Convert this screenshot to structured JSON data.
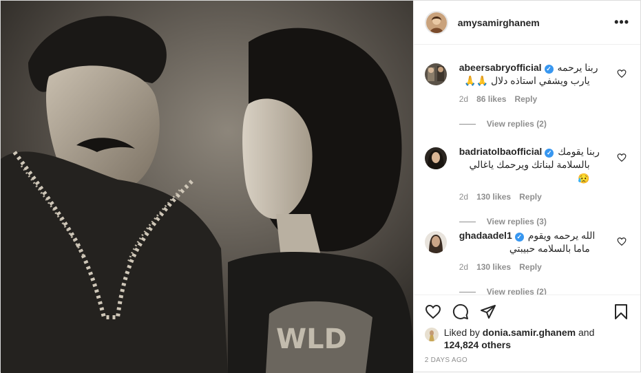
{
  "post": {
    "username": "amysamirghanem",
    "more_label": "•••",
    "photo_alt": "vintage photo"
  },
  "comments": [
    {
      "username": "abeersabryofficial",
      "text_first": "ربنا يرحمه",
      "text_second": "يارب ويشفي استاذه دلال 🙏🙏",
      "time": "2d",
      "likes": "86 likes",
      "reply": "Reply",
      "view_replies": "View replies (2)"
    },
    {
      "username": "badriatolbaofficial",
      "text_first": "ربنا يقومك",
      "text_second": "بالسلامة لبناتك ويرحمك ياغالي😥",
      "time": "2d",
      "likes": "130 likes",
      "reply": "Reply",
      "view_replies": "View replies (3)"
    },
    {
      "username": "ghadaadel1",
      "text_first": "الله يرحمه ويقوم",
      "text_second": "ماما بالسلامه حبيبتي",
      "time": "2d",
      "likes": "130 likes",
      "reply": "Reply",
      "view_replies": "View replies (2)"
    }
  ],
  "likes": {
    "prefix": "Liked by",
    "user": "donia.samir.ghanem",
    "and": "and",
    "count": "124,824 others"
  },
  "timestamp": "2 DAYS AGO",
  "icons": {
    "like": "heart-icon",
    "comment": "comment-icon",
    "share": "share-icon",
    "save": "bookmark-icon"
  },
  "colors": {
    "verified": "#3897f0",
    "muted": "#8e8e8e",
    "text": "#262626"
  }
}
